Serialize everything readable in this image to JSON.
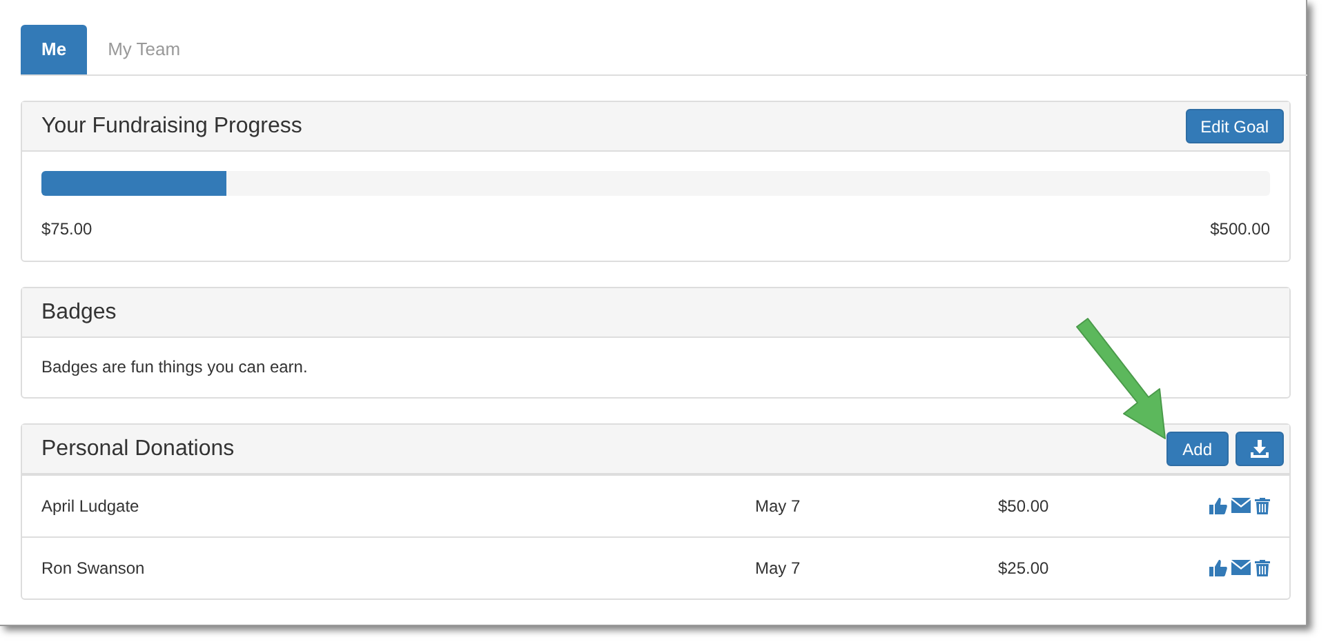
{
  "tabs": [
    {
      "label": "Me",
      "selected": true
    },
    {
      "label": "My Team",
      "selected": false
    }
  ],
  "progress_panel": {
    "title": "Your Fundraising Progress",
    "button": "Edit Goal",
    "level": 0.15,
    "raised": "$75.00",
    "goal": "$500.00"
  },
  "badges_panel": {
    "title": "Badges",
    "text": "Badges are fun things you can earn."
  },
  "donations_panel": {
    "title": "Personal Donations",
    "add_button": "Add",
    "rows": [
      {
        "name": "April Ludgate",
        "date": "May 7",
        "amount": "$50.00"
      },
      {
        "name": "Ron Swanson",
        "date": "May 7",
        "amount": "$25.00"
      }
    ]
  }
}
